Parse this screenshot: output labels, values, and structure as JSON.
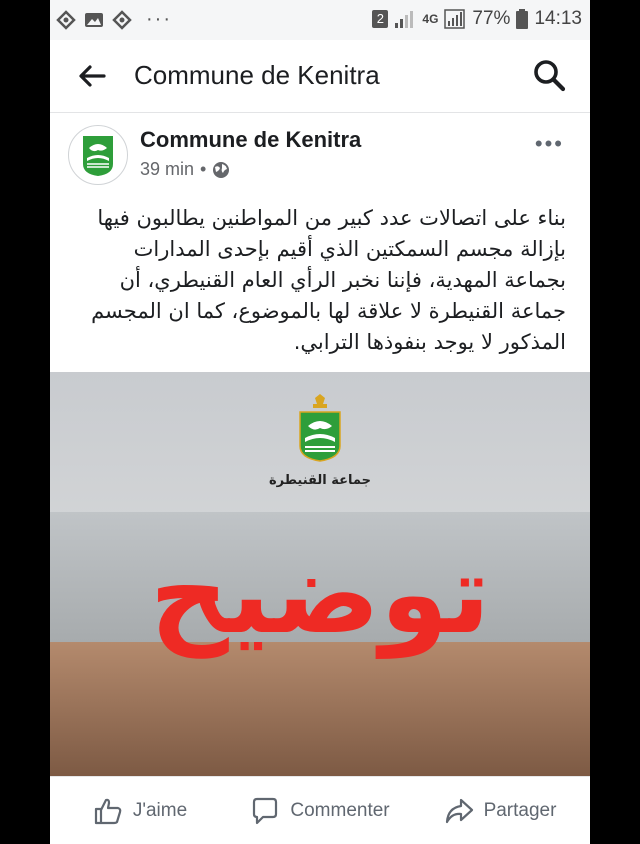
{
  "status_bar": {
    "notification_icons": [
      "vpn-icon",
      "image-icon",
      "vpn-icon"
    ],
    "more_indicator": "···",
    "sim_badge": "2",
    "network_type": "4G",
    "battery_percent": "77%",
    "time": "14:13"
  },
  "app_bar": {
    "title": "Commune de Kenitra"
  },
  "post": {
    "author": "Commune de Kenitra",
    "time_ago": "39 min",
    "separator": "•",
    "audience_icon": "globe-icon",
    "more": "•••",
    "text": "بناء على اتصالات عدد كبير من المواطنين يطالبون فيها بإزالة مجسم السمكتين الذي أقيم بإحدى المدارات بجماعة المهدية، فإننا نخبر الرأي العام القنيطري، أن جماعة القنيطرة لا علاقة لها بالموضوع، كما ان المجسم المذكور لا يوجد بنفوذها الترابي.",
    "image": {
      "logo_caption": "جماعة القنيطرة",
      "headline": "توضيح"
    }
  },
  "actions": {
    "like": "J'aime",
    "comment": "Commenter",
    "share": "Partager"
  },
  "colors": {
    "headline_red": "#ee2a24",
    "logo_green": "#2e9e3a",
    "text_primary": "#1c1e21",
    "text_secondary": "#65676b"
  }
}
